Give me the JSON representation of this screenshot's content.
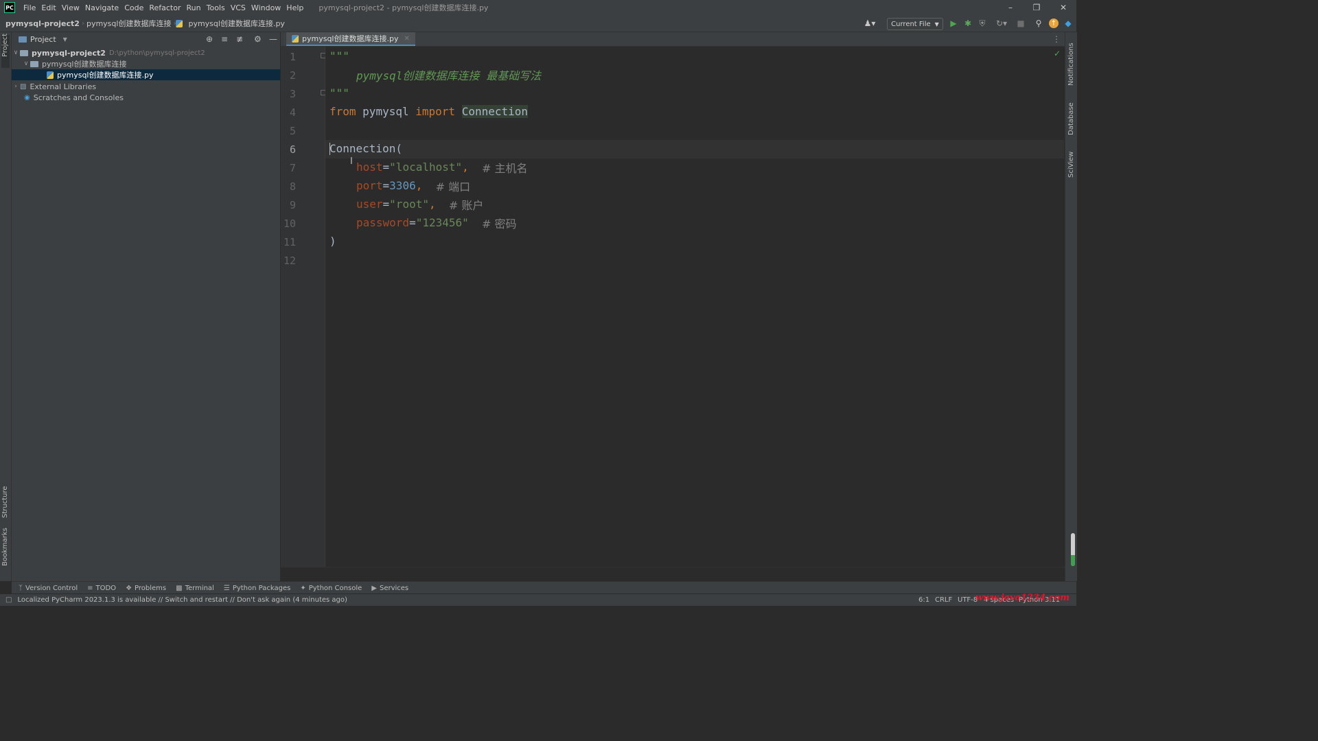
{
  "titlebar": {
    "logo": "PC",
    "menu": [
      "File",
      "Edit",
      "View",
      "Navigate",
      "Code",
      "Refactor",
      "Run",
      "Tools",
      "VCS",
      "Window",
      "Help"
    ],
    "window_title": "pymysql-project2 - pymysql创建数据库连接.py"
  },
  "navbar": {
    "crumbs": [
      "pymysql-project2",
      "pymysql创建数据库连接",
      "pymysql创建数据库连接.py"
    ],
    "run_config": "Current File"
  },
  "leftstripe": {
    "project": "Project",
    "structure": "Structure",
    "bookmarks": "Bookmarks"
  },
  "project_panel": {
    "title": "Project",
    "tree": {
      "root_name": "pymysql-project2",
      "root_path": "D:\\python\\pymysql-project2",
      "folder": "pymysql创建数据库连接",
      "file": "pymysql创建数据库连接.py",
      "external": "External Libraries",
      "scratches": "Scratches and Consoles"
    }
  },
  "editor": {
    "tab_label": "pymysql创建数据库连接.py",
    "current_line": 6,
    "line_numbers": [
      "1",
      "2",
      "3",
      "4",
      "5",
      "6",
      "7",
      "8",
      "9",
      "10",
      "11",
      "12"
    ],
    "code": {
      "l1": "\"\"\"",
      "l2": "pymysql创建数据库连接 最基础写法",
      "l3": "\"\"\"",
      "l4_from": "from",
      "l4_mod": "pymysql",
      "l4_import": "import",
      "l4_name": "Connection",
      "l6": "Connection(",
      "l7_param": "host",
      "l7_val": "\"localhost\"",
      "l7_cmt": "# 主机名",
      "l8_param": "port",
      "l8_val": "3306",
      "l8_cmt": "# 端口",
      "l9_param": "user",
      "l9_val": "\"root\"",
      "l9_cmt": "# 账户",
      "l10_param": "password",
      "l10_val": "\"123456\"",
      "l10_cmt": "# 密码",
      "l11": ")"
    }
  },
  "rightstripe": {
    "notifications": "Notifications",
    "database": "Database",
    "sciview": "SciView"
  },
  "bottom_tools": [
    "Version Control",
    "TODO",
    "Problems",
    "Terminal",
    "Python Packages",
    "Python Console",
    "Services"
  ],
  "statusbar": {
    "message": "Localized PyCharm 2023.1.3 is available // Switch and restart // Don't ask again (4 minutes ago)",
    "position": "6:1",
    "line_sep": "CRLF",
    "encoding": "UTF-8",
    "indent": "4 spaces",
    "interpreter": "Python 3.11",
    "watermark": "www.java1234.com"
  },
  "colors": {
    "keyword": "#cc7832",
    "docstring": "#629755",
    "string": "#6a8759",
    "number": "#6897bb",
    "param": "#aa4926",
    "comment": "#808080",
    "selection": "#0d293e",
    "tab_underline": "#4a88c7"
  }
}
